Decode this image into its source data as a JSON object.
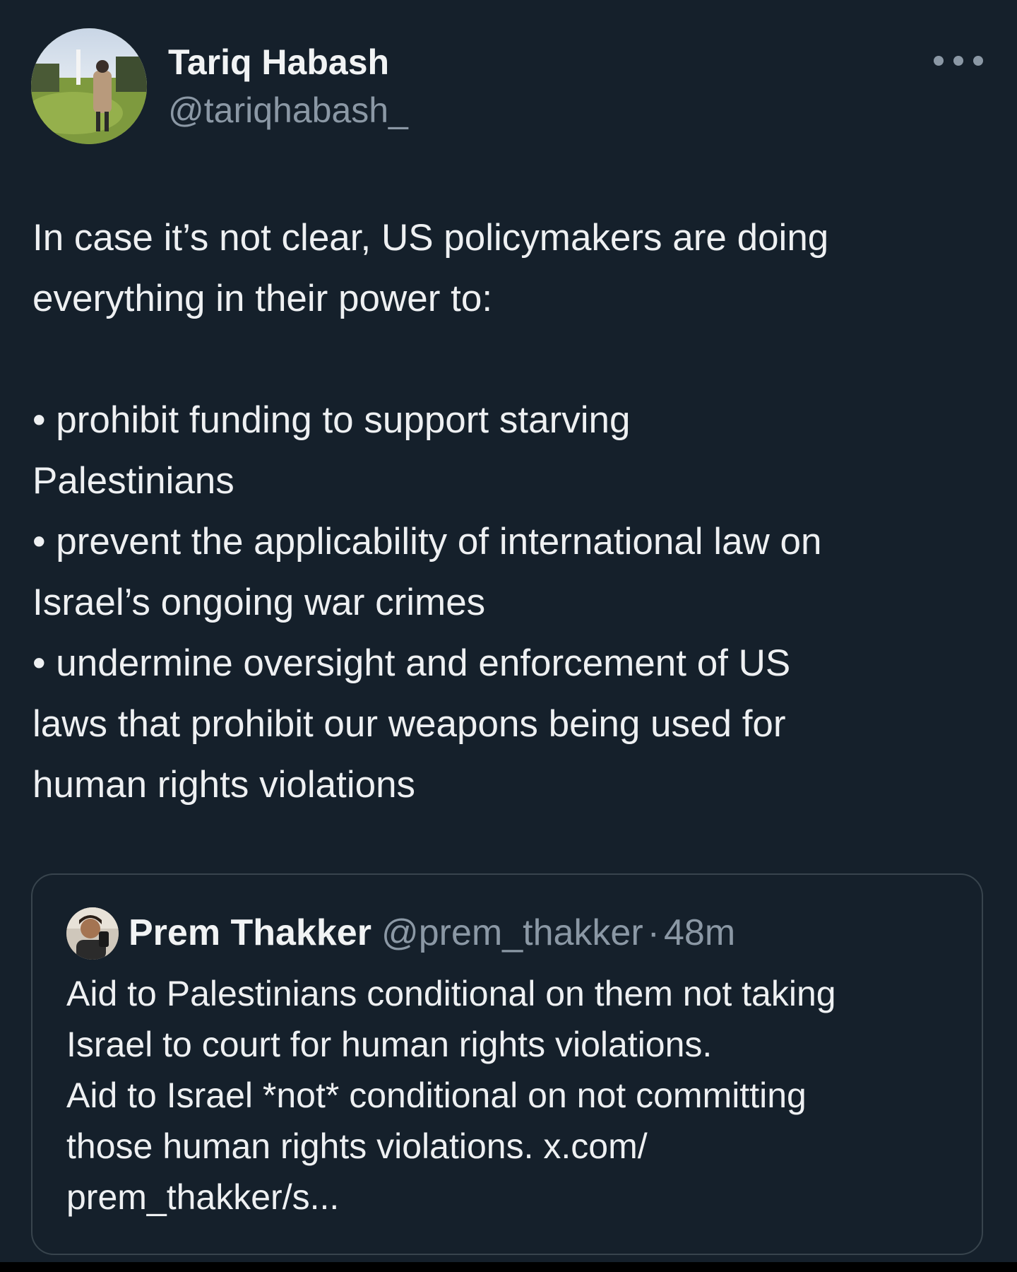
{
  "tweet": {
    "author": {
      "name": "Tariq Habash",
      "handle": "@tariqhabash_"
    },
    "intro_lines": [
      "In case it’s not clear, US policymakers are doing",
      "everything in their power to:"
    ],
    "bullet_lines": [
      "• prohibit funding to support starving",
      "Palestinians",
      "• prevent the applicability of international law on",
      "Israel’s ongoing war crimes",
      "• undermine oversight and enforcement of US",
      "laws that prohibit our weapons being used for",
      "human rights violations"
    ],
    "more_icon": "more-horizontal-icon"
  },
  "quote": {
    "author": {
      "name": "Prem Thakker",
      "handle": "@prem_thakker",
      "separator": "·",
      "time": "48m"
    },
    "lines": [
      "Aid to Palestinians conditional on them not taking",
      "Israel to court for human rights violations.",
      "Aid to Israel *not* conditional on not committing",
      "those human rights violations. x.com/",
      "prem_thakker/s..."
    ]
  },
  "colors": {
    "background": "#15202b",
    "text": "#e7e9ea",
    "secondary_text": "#8b98a5",
    "border": "#38444d"
  }
}
